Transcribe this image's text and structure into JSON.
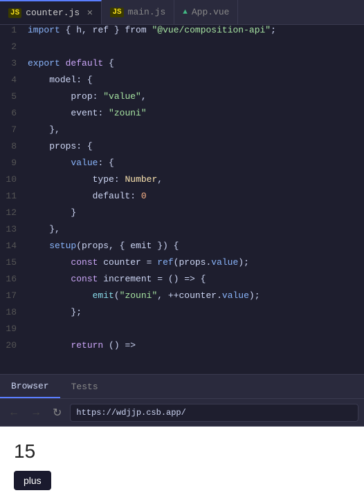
{
  "tabs": [
    {
      "id": "counter-js",
      "icon_type": "js",
      "label": "counter.js",
      "active": true,
      "closable": true
    },
    {
      "id": "main-js",
      "icon_type": "js",
      "label": "main.js",
      "active": false,
      "closable": false
    },
    {
      "id": "app-vue",
      "icon_type": "vue",
      "label": "App.vue",
      "active": false,
      "closable": false
    }
  ],
  "code_lines": [
    {
      "num": "1",
      "tokens": [
        {
          "t": "kw2",
          "v": "import"
        },
        {
          "t": "plain",
          "v": " { "
        },
        {
          "t": "plain",
          "v": "h"
        },
        {
          "t": "plain",
          "v": ", "
        },
        {
          "t": "plain",
          "v": "ref"
        },
        {
          "t": "plain",
          "v": " } "
        },
        {
          "t": "plain",
          "v": "from"
        },
        {
          "t": "plain",
          "v": " "
        },
        {
          "t": "str",
          "v": "\"@vue/composition-api\""
        },
        {
          "t": "plain",
          "v": ";"
        }
      ]
    },
    {
      "num": "2",
      "tokens": []
    },
    {
      "num": "3",
      "tokens": [
        {
          "t": "kw2",
          "v": "export"
        },
        {
          "t": "plain",
          "v": " "
        },
        {
          "t": "kw",
          "v": "default"
        },
        {
          "t": "plain",
          "v": " {"
        }
      ]
    },
    {
      "num": "4",
      "tokens": [
        {
          "t": "plain",
          "v": "    "
        },
        {
          "t": "plain",
          "v": "model"
        },
        {
          "t": "plain",
          "v": ": {"
        }
      ]
    },
    {
      "num": "5",
      "tokens": [
        {
          "t": "plain",
          "v": "        "
        },
        {
          "t": "plain",
          "v": "prop"
        },
        {
          "t": "plain",
          "v": ": "
        },
        {
          "t": "str",
          "v": "\"value\""
        },
        {
          "t": "plain",
          "v": ","
        }
      ]
    },
    {
      "num": "6",
      "tokens": [
        {
          "t": "plain",
          "v": "        "
        },
        {
          "t": "plain",
          "v": "event"
        },
        {
          "t": "plain",
          "v": ": "
        },
        {
          "t": "str",
          "v": "\"zouni\""
        }
      ]
    },
    {
      "num": "7",
      "tokens": [
        {
          "t": "plain",
          "v": "    "
        },
        {
          "t": "plain",
          "v": "},"
        }
      ]
    },
    {
      "num": "8",
      "tokens": [
        {
          "t": "plain",
          "v": "    "
        },
        {
          "t": "plain",
          "v": "props"
        },
        {
          "t": "plain",
          "v": ": {"
        }
      ]
    },
    {
      "num": "9",
      "tokens": [
        {
          "t": "plain",
          "v": "        "
        },
        {
          "t": "val-color",
          "v": "value"
        },
        {
          "t": "plain",
          "v": ": {"
        }
      ]
    },
    {
      "num": "10",
      "tokens": [
        {
          "t": "plain",
          "v": "            "
        },
        {
          "t": "plain",
          "v": "type"
        },
        {
          "t": "plain",
          "v": ": "
        },
        {
          "t": "type-color",
          "v": "Number"
        },
        {
          "t": "plain",
          "v": ","
        }
      ]
    },
    {
      "num": "11",
      "tokens": [
        {
          "t": "plain",
          "v": "            "
        },
        {
          "t": "plain",
          "v": "default"
        },
        {
          "t": "plain",
          "v": ": "
        },
        {
          "t": "num",
          "v": "0"
        }
      ]
    },
    {
      "num": "12",
      "tokens": [
        {
          "t": "plain",
          "v": "        "
        },
        {
          "t": "plain",
          "v": "}"
        }
      ]
    },
    {
      "num": "13",
      "tokens": [
        {
          "t": "plain",
          "v": "    "
        },
        {
          "t": "plain",
          "v": "},"
        }
      ]
    },
    {
      "num": "14",
      "tokens": [
        {
          "t": "plain",
          "v": "    "
        },
        {
          "t": "fn",
          "v": "setup"
        },
        {
          "t": "plain",
          "v": "(props, { emit }) {"
        }
      ]
    },
    {
      "num": "15",
      "tokens": [
        {
          "t": "plain",
          "v": "        "
        },
        {
          "t": "kw",
          "v": "const"
        },
        {
          "t": "plain",
          "v": " counter = "
        },
        {
          "t": "fn",
          "v": "ref"
        },
        {
          "t": "plain",
          "v": "(props."
        },
        {
          "t": "val-color",
          "v": "value"
        },
        {
          "t": "plain",
          "v": ");"
        }
      ]
    },
    {
      "num": "16",
      "tokens": [
        {
          "t": "plain",
          "v": "        "
        },
        {
          "t": "kw",
          "v": "const"
        },
        {
          "t": "plain",
          "v": " increment = () => {"
        }
      ]
    },
    {
      "num": "17",
      "tokens": [
        {
          "t": "plain",
          "v": "            "
        },
        {
          "t": "method",
          "v": "emit"
        },
        {
          "t": "plain",
          "v": "("
        },
        {
          "t": "str",
          "v": "\"zouni\""
        },
        {
          "t": "plain",
          "v": ", ++counter."
        },
        {
          "t": "val-color",
          "v": "value"
        },
        {
          "t": "plain",
          "v": ");"
        }
      ]
    },
    {
      "num": "18",
      "tokens": [
        {
          "t": "plain",
          "v": "        "
        },
        {
          "t": "plain",
          "v": "};"
        }
      ]
    },
    {
      "num": "19",
      "tokens": []
    },
    {
      "num": "20",
      "tokens": [
        {
          "t": "plain",
          "v": "        "
        },
        {
          "t": "kw",
          "v": "return"
        },
        {
          "t": "plain",
          "v": " () =>"
        }
      ]
    }
  ],
  "bottom_tabs": [
    {
      "id": "browser",
      "label": "Browser",
      "active": true
    },
    {
      "id": "tests",
      "label": "Tests",
      "active": false
    }
  ],
  "browser": {
    "url": "https://wdjjp.csb.app/",
    "back_disabled": true,
    "forward_disabled": true
  },
  "preview": {
    "count": "15",
    "button_label": "plus"
  },
  "colors": {
    "accent": "#5a7eff",
    "bg_dark": "#1e1e2e",
    "bg_mid": "#2a2a3d",
    "border": "#3a3a50"
  }
}
